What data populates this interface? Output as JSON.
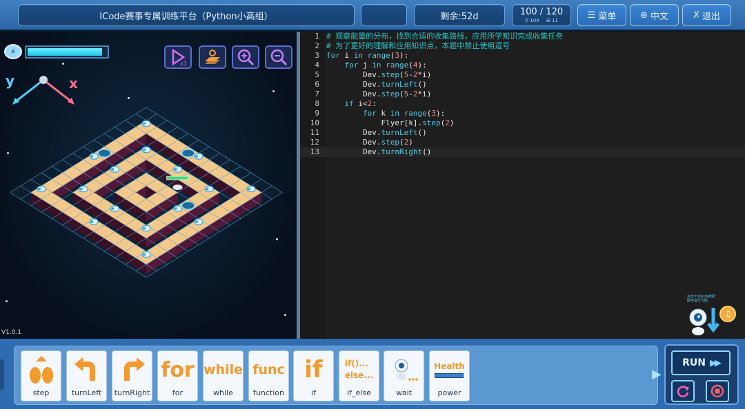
{
  "topbar": {
    "title": "ICode赛事专属训练平台（Python小高组）",
    "remaining": "剩余:52d",
    "score": "100 / 120",
    "score_sub_a": "104",
    "score_sub_b": "11",
    "menu_label": "菜单",
    "lang_label": "中文",
    "exit_label": "退出"
  },
  "stage": {
    "energy_percent": 95,
    "axis_y": "y",
    "axis_x": "x",
    "version": "V1.0.1",
    "tools": [
      "play-recording-icon",
      "map-icon",
      "zoom-in-icon",
      "zoom-out-icon"
    ]
  },
  "editor": {
    "lines": [
      {
        "n": "1",
        "t": "# 观察能量的分布，找到合适的收集路线，应用所学知识完成收集任务"
      },
      {
        "n": "2",
        "t": "# 为了更好的理解和应用知识点，本题中禁止使用逗号"
      },
      {
        "n": "3",
        "t": "for i in range(3):"
      },
      {
        "n": "4",
        "t": "    for j in range(4):"
      },
      {
        "n": "5",
        "t": "        Dev.step(5-2*i)"
      },
      {
        "n": "6",
        "t": "        Dev.turnLeft()"
      },
      {
        "n": "7",
        "t": "        Dev.step(5-2*i)"
      },
      {
        "n": "8",
        "t": "    if i<2:"
      },
      {
        "n": "9",
        "t": "        for k in range(3):"
      },
      {
        "n": "10",
        "t": "            Flyer[k].step(2)"
      },
      {
        "n": "11",
        "t": "        Dev.turnLeft()"
      },
      {
        "n": "12",
        "t": "        Dev.step(2)"
      },
      {
        "n": "13",
        "t": "        Dev.turnRight()"
      }
    ]
  },
  "helper": {
    "hint_line1": "点击下方RUN按钮",
    "hint_line2": "即可运行代码"
  },
  "blocks": [
    {
      "label": "step",
      "glyph": "step-icon"
    },
    {
      "label": "turnLeft",
      "glyph": "turn-left-icon"
    },
    {
      "label": "turnRight",
      "glyph": "turn-right-icon"
    },
    {
      "label": "for",
      "glyph": "for"
    },
    {
      "label": "while",
      "glyph": "while"
    },
    {
      "label": "function",
      "glyph": "func"
    },
    {
      "label": "if",
      "glyph": "if"
    },
    {
      "label": "if_else",
      "glyph": "if()...\nelse..."
    },
    {
      "label": "wait",
      "glyph": "wait-icon"
    },
    {
      "label": "power",
      "glyph": "Health"
    }
  ],
  "run": {
    "label": "RUN"
  },
  "colors": {
    "accent": "#2e6bb0",
    "comment": "#24c0c8",
    "keyword": "#4ec9e0",
    "number": "#f08a8a",
    "path_tile": "#f3c98b",
    "grid": "#5fb3e6",
    "block_orange": "#f29a2e"
  }
}
